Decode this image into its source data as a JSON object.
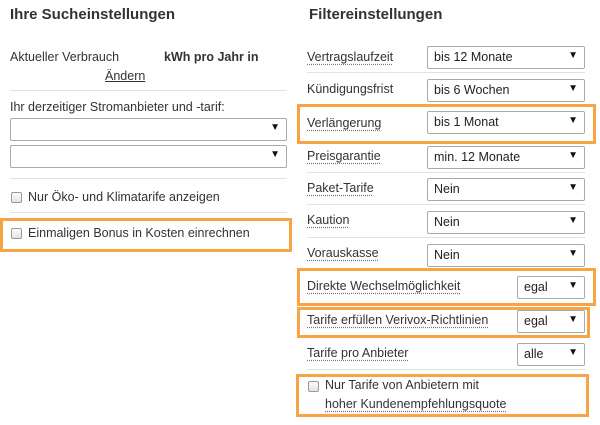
{
  "colors": {
    "highlight": "#f6a445",
    "text": "#333333",
    "separator": "#e2e2e2"
  },
  "left": {
    "title": "Ihre Sucheinstellungen",
    "consumption_label": "Aktueller Verbrauch",
    "consumption_unit": "kWh pro Jahr in",
    "change_link": "Ändern",
    "provider_label": "Ihr derzeitiger Stromanbieter und -tarif:",
    "provider_value": "",
    "tariff_value": "",
    "eco_label": "Nur Öko- und Klimatarife anzeigen",
    "bonus_label": "Einmaligen Bonus in Kosten einrechnen"
  },
  "right": {
    "title": "Filtereinstellungen",
    "rows": [
      {
        "label": "Vertragslaufzeit",
        "value": "bis 12 Monate"
      },
      {
        "label": "Kündigungsfrist",
        "value": "bis 6 Wochen"
      },
      {
        "label": "Verlängerung",
        "value": "bis 1 Monat"
      },
      {
        "label": "Preisgarantie",
        "value": "min. 12 Monate"
      },
      {
        "label": "Paket-Tarife",
        "value": "Nein"
      },
      {
        "label": "Kaution",
        "value": "Nein"
      },
      {
        "label": "Vorauskasse",
        "value": "Nein"
      },
      {
        "label": "Direkte Wechselmöglichkeit",
        "value": "egal"
      },
      {
        "label": "Tarife erfüllen Verivox-Richtlinien",
        "value": "egal"
      },
      {
        "label": "Tarife pro Anbieter",
        "value": "alle"
      }
    ],
    "recommend_line1": "Nur Tarife von Anbietern mit",
    "recommend_line2": "hoher Kundenempfehlungsquote"
  },
  "icons": {
    "dropdown": "triangle-down"
  }
}
